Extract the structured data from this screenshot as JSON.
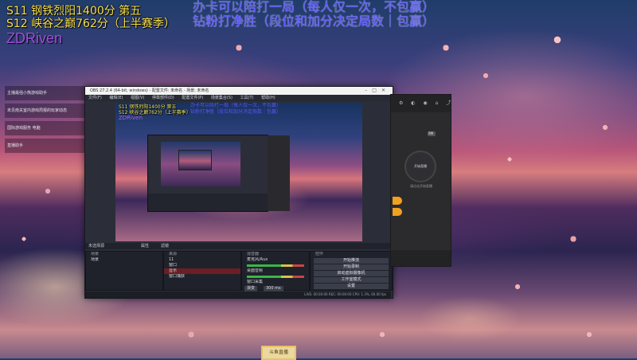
{
  "overlay": {
    "line1": "S11 钢铁烈阳1400分 第五",
    "line2": "S12 峡谷之巅762分（上半赛季）",
    "streamer": "ZDRiven",
    "notice1": "办卡可以陪打一局（每人仅一次，不包赢）",
    "notice2": "钻粉打净胜（段位和加分决定局数｜包赢）"
  },
  "desktop_list": [
    "主播最强小熊游戏助手",
    "未见南关室内游戏周报的玩家动态",
    "国际游戏服务 电脑",
    "直播助手"
  ],
  "obs": {
    "title": "OBS 27.2.4 (64-bit, windows) - 配置文件: 未命名 - 场景: 未命名",
    "menu": [
      "文件(F)",
      "编辑(E)",
      "视图(V)",
      "停靠部件(D)",
      "配置文件(P)",
      "场景集合(S)",
      "工具(T)",
      "帮助(H)"
    ],
    "preview_overlay": {
      "line1": "S11 钢铁烈阳1400分 第五",
      "line2": "S12 峡谷之巅762分（上半赛季）",
      "streamer": "ZDRiven",
      "notice1": "办卡可以陪打一局（每人仅一次，不包赢）",
      "notice2": "钻粉打净胜（段位和加分决定局数｜包赢）"
    },
    "dock_labels": {
      "scenes": "未选择源",
      "properties": "属性",
      "filters": "滤镜",
      "scenes_header": "场景",
      "sources_header": "来源",
      "mixer_header": "混音器",
      "transitions_header": "转场特效",
      "controls_header": "控件"
    },
    "scenes": [
      "场景"
    ],
    "sources": [
      "11",
      "窗口",
      "显示",
      "窗口捕获"
    ],
    "mixer": [
      "麦克风/Aux",
      "桌面音频",
      "窗口采集"
    ],
    "transition": {
      "label": "渐变",
      "duration_label": "持续时间",
      "duration": "300 ms"
    },
    "controls": [
      "开始推流",
      "开始录制",
      "启动虚拟摄像机",
      "工作室模式",
      "设置",
      "退出"
    ],
    "status": "LIVE: 00:00:00   REC: 00:00:00   CPU: 1.3%, 60.00 fps"
  },
  "right_panel": {
    "badge": "直播",
    "circle_label": "开始直播",
    "caption": "请点击开始直播"
  },
  "logo": "斗鱼直播"
}
